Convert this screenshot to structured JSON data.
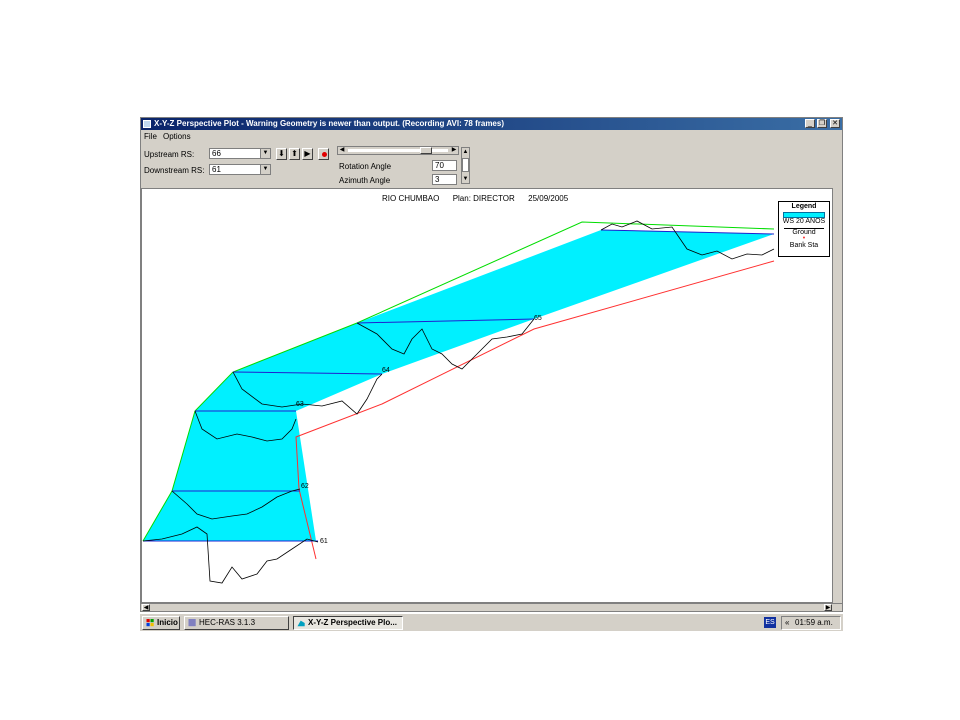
{
  "window": {
    "title": "X-Y-Z Perspective Plot - Warning Geometry is newer than output. (Recording AVI: 78 frames)",
    "min_glyph": "_",
    "max_glyph": "❐",
    "close_glyph": "✕"
  },
  "menu": {
    "file": "File",
    "options": "Options"
  },
  "controls": {
    "upstream_label": "Upstream RS:",
    "upstream_value": "66",
    "downstream_label": "Downstream RS:",
    "downstream_value": "61",
    "rotation_label": "Rotation Angle",
    "rotation_value": "70",
    "azimuth_label": "Azimuth Angle",
    "azimuth_value": "3",
    "btn_down": "⬇",
    "btn_up": "⬆",
    "btn_play": "▶"
  },
  "plot": {
    "title_river": "RIO CHUMBAO",
    "title_plan": "Plan: DIRECTOR",
    "title_date": "25/09/2005",
    "station_labels": [
      "61",
      "62",
      "63",
      "64",
      "65"
    ]
  },
  "legend": {
    "title": "Legend",
    "ws": "WS 20 ANOS",
    "ground": "Ground",
    "bank": "Bank Sta"
  },
  "colors": {
    "water": "#00f0ff",
    "bank_left": "#00dd00",
    "bank_right": "#ff3030",
    "section": "#2020d0",
    "ground": "#000000"
  },
  "taskbar": {
    "start": "Inicio",
    "item1": "HEC-RAS 3.1.3",
    "item2": "X-Y-Z Perspective Plo...",
    "lang": "ES",
    "chevron": "«",
    "clock": "01:59 a.m."
  }
}
